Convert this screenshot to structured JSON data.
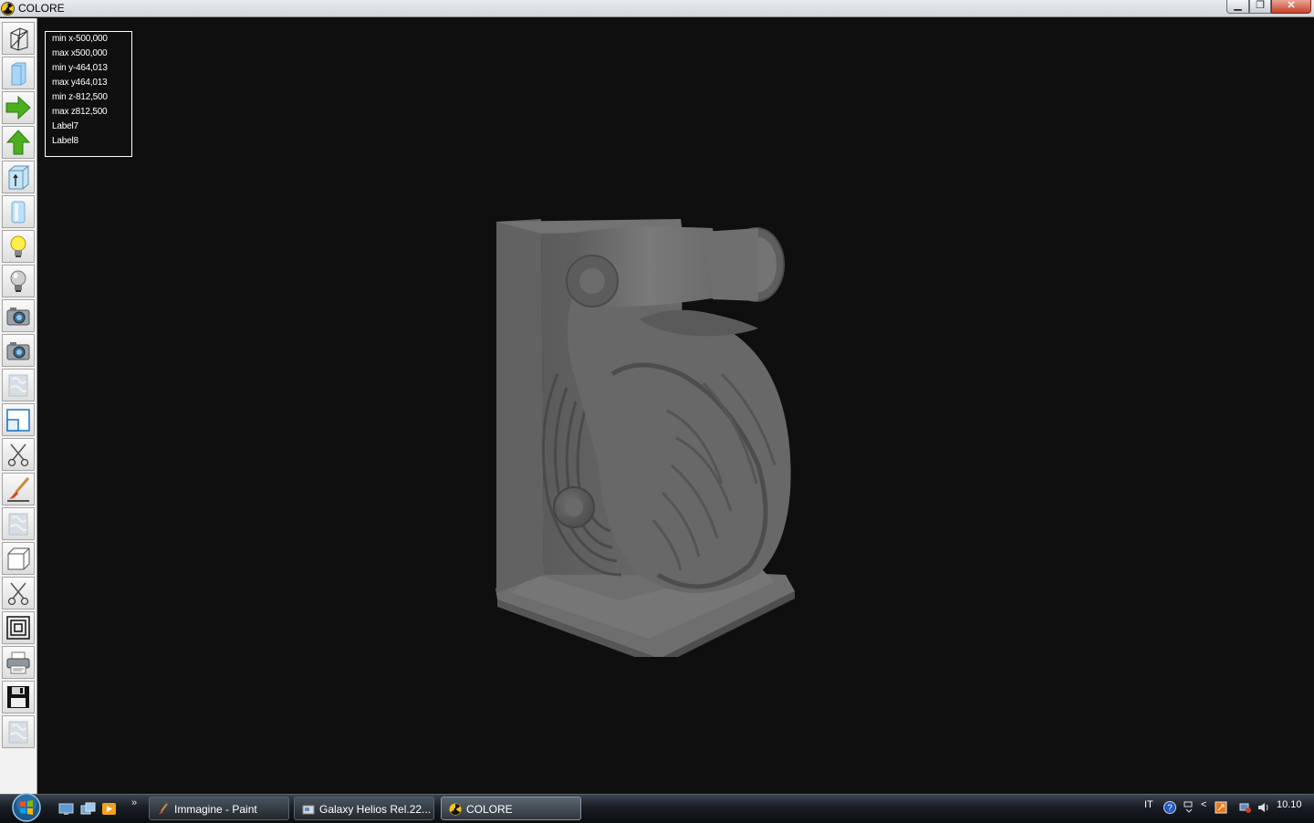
{
  "window": {
    "title": "COLORE",
    "minimize_glyph": "▁",
    "maximize_glyph": "❐",
    "close_glyph": "✕"
  },
  "toolbar": {
    "tools": [
      {
        "name": "wireframe-icon"
      },
      {
        "name": "solid-box-icon"
      },
      {
        "name": "arrow-right-icon",
        "color": "#4caf1e"
      },
      {
        "name": "arrow-up-icon",
        "color": "#4caf1e"
      },
      {
        "name": "box-normal-icon"
      },
      {
        "name": "cylinder-icon"
      },
      {
        "name": "lightbulb-on-icon"
      },
      {
        "name": "lightbulb-off-icon"
      },
      {
        "name": "camera-icon"
      },
      {
        "name": "camera-icon-2"
      },
      {
        "name": "texture-icon"
      },
      {
        "name": "viewport-icon"
      },
      {
        "name": "scissors-icon"
      },
      {
        "name": "brush-icon"
      },
      {
        "name": "texture-icon-2"
      },
      {
        "name": "cube-icon"
      },
      {
        "name": "scissors-icon-2"
      },
      {
        "name": "nested-squares-icon"
      },
      {
        "name": "printer-icon"
      },
      {
        "name": "floppy-disk-icon"
      },
      {
        "name": "texture-icon-3"
      }
    ]
  },
  "info": {
    "lines": [
      "min x-500,000",
      "max x500,000",
      "min y-464,013",
      "max y464,013",
      "min z-812,500",
      "max z812,500",
      "Label7",
      "Label8"
    ]
  },
  "taskbar": {
    "more_glyph": "»",
    "tasks": [
      {
        "label": "Immagine - Paint",
        "active": false
      },
      {
        "label": "Galaxy Helios  Rel.22...",
        "active": false
      },
      {
        "label": "COLORE",
        "active": true
      }
    ],
    "language": "IT",
    "chevron": "<",
    "time": "10.10"
  },
  "colors": {
    "viewport_bg": "#0f0f0f",
    "model": "#6a6a6a",
    "green_arrow": "#4caf1e"
  }
}
